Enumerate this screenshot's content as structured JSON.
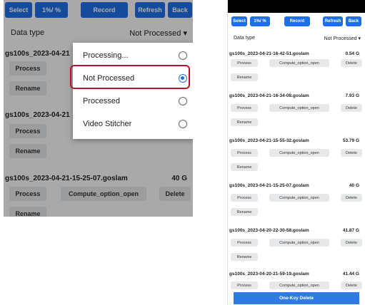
{
  "toolbar": {
    "select_label": "Select",
    "ratio_label": "1%/ %",
    "record_label": "Record",
    "refresh_label": "Refresh",
    "back_label": "Back"
  },
  "filter": {
    "label": "Data type",
    "value": "Not Processed",
    "chevron": "chevron-down-icon"
  },
  "left_screen": {
    "files": [
      {
        "name": "gs100s_2023-04-21",
        "size": ""
      },
      {
        "name": "gs100s_2023-04-21",
        "size": ""
      },
      {
        "name": "gs100s_2023-04-21-15-25-07.goslam",
        "size": "40 G"
      }
    ],
    "dialog": {
      "options": [
        {
          "label": "Processing...",
          "selected": false
        },
        {
          "label": "Not Processed",
          "selected": true
        },
        {
          "label": "Processed",
          "selected": false
        },
        {
          "label": "Video Stitcher",
          "selected": false
        }
      ],
      "highlight_color": "#b3162a"
    }
  },
  "right_screen": {
    "files": [
      {
        "name": "gs100s_2023-04-21-16-42-51.goslam",
        "size": "0.54 G",
        "rename": false
      },
      {
        "name": "gs100s_2023-04-21-16-34-08.goslam",
        "size": "7.93 G",
        "rename": true
      },
      {
        "name": "gs100s_2023-04-21-15-55-32.goslam",
        "size": "53.79 G",
        "rename": true
      },
      {
        "name": "gs100s_2023-04-21-15-25-07.goslam",
        "size": "40 G",
        "rename": true
      },
      {
        "name": "gs100s_2023-04-20-22-30-58.goslam",
        "size": "41.87 G",
        "rename": true
      },
      {
        "name": "gs100s_2023-04-20-21-59-19.goslam",
        "size": "41.44 G",
        "rename": false
      }
    ],
    "one_key_delete_label": "One-Key Delete"
  },
  "actions": {
    "process_label": "Process",
    "compute_label": "Compute_option_open",
    "delete_label": "Delete",
    "rename_label": "Rename"
  },
  "colors": {
    "accent": "#1e6fe6",
    "button_bg": "#e6e8ea",
    "bottom_bar": "#2d7be5"
  }
}
